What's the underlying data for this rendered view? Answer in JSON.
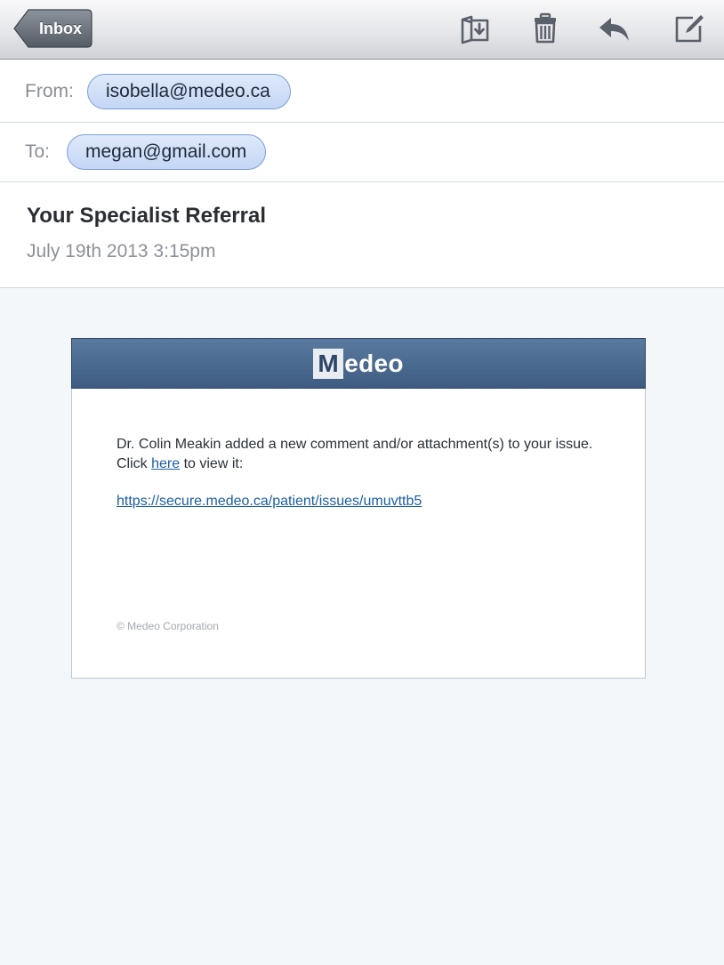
{
  "toolbar": {
    "back_label": "Inbox",
    "icons": [
      "move-to-folder-icon",
      "trash-icon",
      "reply-icon",
      "compose-icon"
    ]
  },
  "header": {
    "from_label": "From:",
    "from_value": "isobella@medeo.ca",
    "to_label": "To:",
    "to_value": "megan@gmail.com",
    "subject": "Your Specialist Referral",
    "date": "July 19th 2013 3:15pm"
  },
  "email": {
    "logo_initial": "M",
    "logo_rest": "edeo",
    "message_line1": "Dr. Colin Meakin added a new comment and/or attachment(s) to your issue.",
    "message_click": "Click ",
    "message_link": "here",
    "message_tail": " to view it:",
    "url": "https://secure.medeo.ca/patient/issues/umuvttb5",
    "copyright": "© Medeo Corporation"
  },
  "colors": {
    "accent": "#1a5fa6",
    "header_bar": "#4a6a91",
    "pill": "#c4d6f5"
  }
}
